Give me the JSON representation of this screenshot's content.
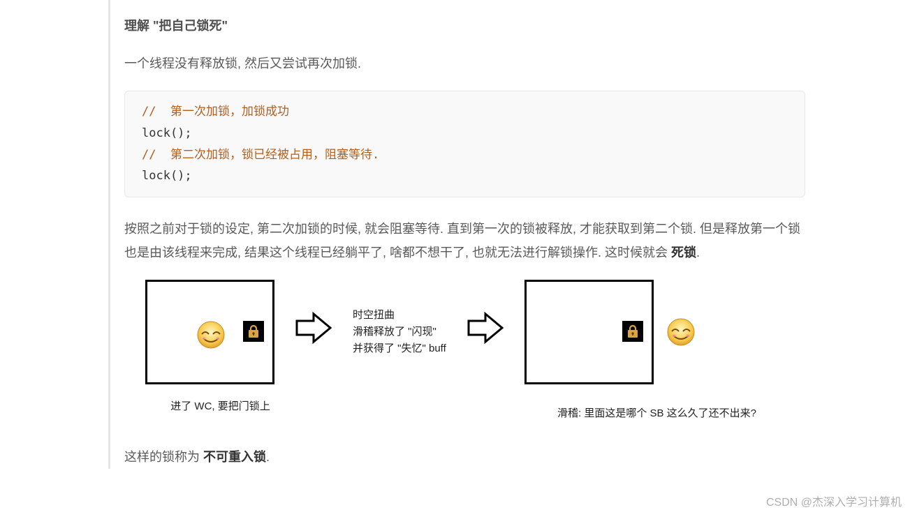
{
  "heading": "理解 \"把自己锁死\"",
  "para1": "一个线程没有释放锁, 然后又尝试再次加锁.",
  "code": {
    "c1": "//  第一次加锁，加锁成功",
    "l1": "lock();",
    "c2": "//  第二次加锁，锁已经被占用，阻塞等待.",
    "l2": "lock();"
  },
  "para2a": "按照之前对于锁的设定, 第二次加锁的时候, 就会阻塞等待. 直到第一次的锁被释放, 才能获取到第二个锁. 但是释放第一个锁也是由该线程来完成, 结果这个线程已经躺平了, 啥都不想干了, 也就无法进行解锁操作. 这时候就会 ",
  "para2b": "死锁",
  "para2c": ".",
  "diagram": {
    "mid1": "时空扭曲",
    "mid2": "滑稽释放了 \"闪现\"",
    "mid3": "并获得了 \"失忆\" buff",
    "cap_left": "进了 WC, 要把门锁上",
    "cap_right": "滑稽: 里面这是哪个 SB 这么久了还不出来?"
  },
  "para3a": "这样的锁称为 ",
  "para3b": "不可重入锁",
  "para3c": ".",
  "watermark": "CSDN @杰深入学习计算机"
}
